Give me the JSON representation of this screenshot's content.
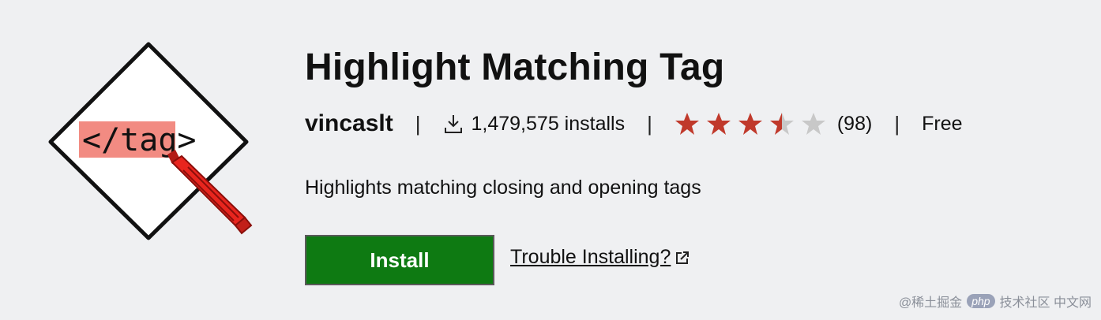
{
  "extension": {
    "title": "Highlight Matching Tag",
    "publisher": "vincaslt",
    "installs": "1,479,575 installs",
    "rating": 3.5,
    "rating_max": 5,
    "rating_count": "(98)",
    "price": "Free",
    "description": "Highlights matching closing and opening tags",
    "separator": "|"
  },
  "logo": {
    "text": "</tag>",
    "icon": "highlighter-marker-icon",
    "highlight_color": "#f28b82",
    "marker_color": "#e8251e"
  },
  "actions": {
    "install_label": "Install",
    "trouble_label": "Trouble Installing?"
  },
  "colors": {
    "install_button": "#0e7a12",
    "star_filled": "#c0392b",
    "star_empty": "#c8c8c8"
  },
  "watermark": {
    "prefix": "@稀土掘金",
    "badge": "php",
    "suffix": "技术社区 中文网"
  }
}
